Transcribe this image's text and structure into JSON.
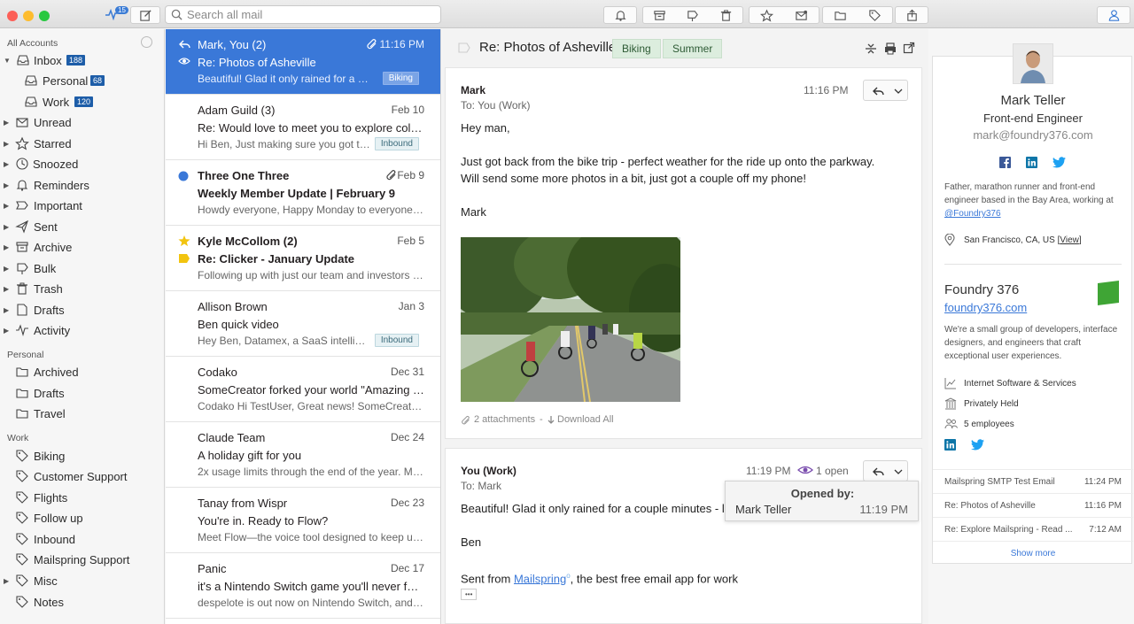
{
  "toolbar": {
    "activity_count": "15",
    "search_placeholder": "Search all mail"
  },
  "sidebar": {
    "all_accounts": "All Accounts",
    "inbox": {
      "label": "Inbox",
      "count": "188"
    },
    "personal": {
      "label": "Personal",
      "count": "68"
    },
    "work": {
      "label": "Work",
      "count": "120"
    },
    "folders": [
      "Unread",
      "Starred",
      "Snoozed",
      "Reminders",
      "Important",
      "Sent",
      "Archive",
      "Bulk",
      "Trash",
      "Drafts",
      "Activity"
    ],
    "personal_section": "Personal",
    "personal_folders": [
      "Archived",
      "Drafts",
      "Travel"
    ],
    "work_section": "Work",
    "work_labels": [
      "Biking",
      "Customer Support",
      "Flights",
      "Follow up",
      "Inbound",
      "Mailspring Support",
      "Misc",
      "Notes"
    ]
  },
  "messages": [
    {
      "from": "Mark, You (2)",
      "date": "11:16 PM",
      "subject": "Re: Photos of Asheville",
      "snippet": "Beautiful! Glad it only rained for a couple...",
      "tag": "Biking"
    },
    {
      "from": "Adam Guild (3)",
      "date": "Feb 10",
      "subject": "Re: Would love to meet you to explore collabor...",
      "snippet": "Hi Ben, Just making sure you got this!...",
      "tag": "Inbound"
    },
    {
      "from": "Three One Three",
      "date": "Feb 9",
      "subject": "Weekly Member Update | February 9",
      "snippet": "Howdy everyone, Happy Monday to everyone! ...",
      "tag": ""
    },
    {
      "from": "Kyle McCollom (2)",
      "date": "Feb 5",
      "subject": "Re: Clicker - January Update",
      "snippet": "Following up with just our team and investors to...",
      "tag": ""
    },
    {
      "from": "Allison Brown",
      "date": "Jan 3",
      "subject": "Ben quick video",
      "snippet": "Hey Ben, Datamex, a SaaS intelligence...",
      "tag": "Inbound"
    },
    {
      "from": "Codako",
      "date": "Dec 31",
      "subject": "SomeCreator forked your world \"Amazing Tes...",
      "snippet": "Codako Hi TestUser, Great news! SomeCreator j...",
      "tag": ""
    },
    {
      "from": "Claude Team",
      "date": "Dec 24",
      "subject": "A holiday gift for you",
      "snippet": "2x usage limits through the end of the year. Mor...",
      "tag": ""
    },
    {
      "from": "Tanay from Wispr",
      "date": "Dec 23",
      "subject": "You're in. Ready to Flow?",
      "snippet": "Meet Flow—the voice tool designed to keep up ...",
      "tag": ""
    },
    {
      "from": "Panic",
      "date": "Dec 17",
      "subject": "it's a Nintendo Switch game you'll never forget",
      "snippet": "despelote is out now on Nintendo Switch, and y...",
      "tag": ""
    }
  ],
  "thread": {
    "title": "Re: Photos of Asheville",
    "labels": [
      "Biking",
      "Summer"
    ],
    "message1": {
      "from": "Mark",
      "to": "To: You (Work)",
      "time": "11:16 PM",
      "greeting": "Hey man,",
      "body": "Just got back from the bike trip - perfect weather for the ride up onto the parkway. Will send some more photos in a bit, just got a couple off my phone!",
      "signoff": "Mark",
      "attachments": "2 attachments",
      "download_all": "Download All"
    },
    "message2": {
      "from": "You (Work)",
      "to": "To: Mark",
      "time": "11:19 PM",
      "opens": "1 open",
      "body": "Beautiful! Glad it only rained for a couple minutes - let",
      "signoff": "Ben",
      "sent_from_prefix": "Sent from ",
      "sent_from_link": "Mailspring",
      "sent_from_suffix": ", the best free email app for work",
      "ellipsis": "•••"
    },
    "popup": {
      "title": "Opened by:",
      "name": "Mark Teller",
      "time": "11:19 PM"
    }
  },
  "contact": {
    "name": "Mark Teller",
    "title": "Front-end Engineer",
    "email": "mark@foundry376.com",
    "bio": "Father, marathon runner and front-end engineer based in the Bay Area, working at",
    "bio_handle": "@Foundry376",
    "location": "San Francisco, CA, US",
    "location_view": "View",
    "company": "Foundry 376",
    "company_url": "foundry376.com",
    "company_desc": "We're a small group of developers, interface designers, and engineers that craft exceptional user experiences.",
    "industry": "Internet Software & Services",
    "ownership": "Privately Held",
    "employees": "5 employees",
    "related": [
      {
        "subject": "Mailspring SMTP Test Email",
        "time": "11:24 PM"
      },
      {
        "subject": "Re: Photos of Asheville",
        "time": "11:16 PM"
      },
      {
        "subject": "Re: Explore Mailspring - Read ...",
        "time": "7:12 AM"
      }
    ],
    "show_more": "Show more"
  },
  "colors": {
    "accent": "#3a78d8",
    "badge": "#1d5da8",
    "label_green": "#dcedde",
    "twitter": "#1da1f2",
    "facebook": "#3b5998",
    "linkedin": "#0e76a8"
  }
}
